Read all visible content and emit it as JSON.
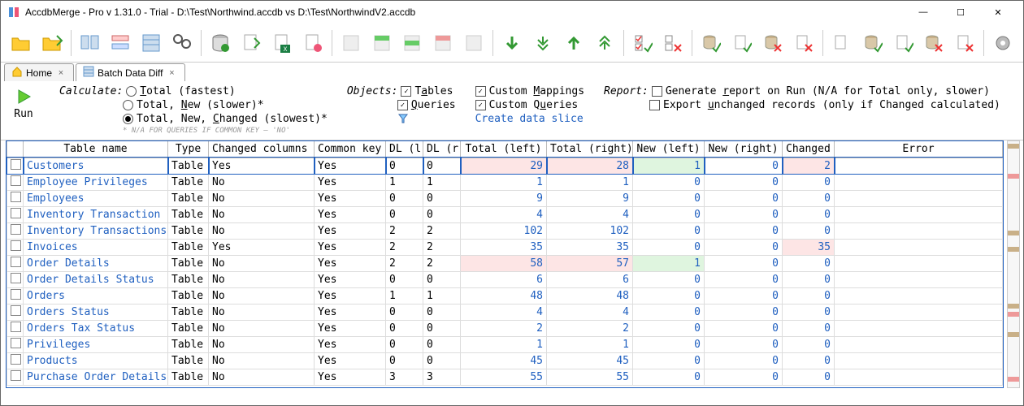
{
  "window": {
    "title": "AccdbMerge - Pro v 1.31.0 - Trial - D:\\Test\\Northwind.accdb vs D:\\Test\\NorthwindV2.accdb"
  },
  "tabs": {
    "home": "Home",
    "active": "Batch Data Diff"
  },
  "run": {
    "label": "Run"
  },
  "calculate": {
    "label": "Calculate:",
    "opt1": "Total (fastest)",
    "opt2": "Total, New (slower)*",
    "opt3": "Total, New, Changed (slowest)*",
    "fine": "* N/A FOR QUERIES IF COMMON KEY – 'NO'"
  },
  "objects": {
    "label": "Objects:",
    "tables": "Tables",
    "queries": "Queries"
  },
  "custom": {
    "mappings": "Custom Mappings",
    "queries": "Custom Queries",
    "slice": "Create data slice"
  },
  "report": {
    "label": "Report:",
    "generate": "Generate report on Run (N/A for Total only, slower)",
    "export": "Export unchanged records (only if Changed calculated)"
  },
  "columns": {
    "c0": "",
    "c1": "Table name",
    "c2": "Type",
    "c3": "Changed columns",
    "c4": "Common key",
    "c5": "DL (l",
    "c6": "DL (r",
    "c7": "Total (left)",
    "c8": "Total (right)",
    "c9": "New (left)",
    "c10": "New (right)",
    "c11": "Changed",
    "c12": "Error"
  },
  "rows": [
    {
      "name": "Customers",
      "type": "Table",
      "chgcol": "Yes",
      "key": "Yes",
      "dll": "0",
      "dlr": "0",
      "tl": "29",
      "tr": "28",
      "nl": "1",
      "nr": "0",
      "ch": "2",
      "hl": {
        "tl": "pink",
        "tr": "pink",
        "nl": "green",
        "ch": "pink"
      },
      "sel": true
    },
    {
      "name": "Employee Privileges",
      "type": "Table",
      "chgcol": "No",
      "key": "Yes",
      "dll": "1",
      "dlr": "1",
      "tl": "1",
      "tr": "1",
      "nl": "0",
      "nr": "0",
      "ch": "0"
    },
    {
      "name": "Employees",
      "type": "Table",
      "chgcol": "No",
      "key": "Yes",
      "dll": "0",
      "dlr": "0",
      "tl": "9",
      "tr": "9",
      "nl": "0",
      "nr": "0",
      "ch": "0"
    },
    {
      "name": "Inventory Transaction",
      "type": "Table",
      "chgcol": "No",
      "key": "Yes",
      "dll": "0",
      "dlr": "0",
      "tl": "4",
      "tr": "4",
      "nl": "0",
      "nr": "0",
      "ch": "0"
    },
    {
      "name": "Inventory Transactions",
      "type": "Table",
      "chgcol": "No",
      "key": "Yes",
      "dll": "2",
      "dlr": "2",
      "tl": "102",
      "tr": "102",
      "nl": "0",
      "nr": "0",
      "ch": "0"
    },
    {
      "name": "Invoices",
      "type": "Table",
      "chgcol": "Yes",
      "key": "Yes",
      "dll": "2",
      "dlr": "2",
      "tl": "35",
      "tr": "35",
      "nl": "0",
      "nr": "0",
      "ch": "35",
      "hl": {
        "ch": "pink"
      }
    },
    {
      "name": "Order Details",
      "type": "Table",
      "chgcol": "No",
      "key": "Yes",
      "dll": "2",
      "dlr": "2",
      "tl": "58",
      "tr": "57",
      "nl": "1",
      "nr": "0",
      "ch": "0",
      "hl": {
        "tl": "pink",
        "tr": "pink",
        "nl": "green"
      }
    },
    {
      "name": "Order Details Status",
      "type": "Table",
      "chgcol": "No",
      "key": "Yes",
      "dll": "0",
      "dlr": "0",
      "tl": "6",
      "tr": "6",
      "nl": "0",
      "nr": "0",
      "ch": "0"
    },
    {
      "name": "Orders",
      "type": "Table",
      "chgcol": "No",
      "key": "Yes",
      "dll": "1",
      "dlr": "1",
      "tl": "48",
      "tr": "48",
      "nl": "0",
      "nr": "0",
      "ch": "0"
    },
    {
      "name": "Orders Status",
      "type": "Table",
      "chgcol": "No",
      "key": "Yes",
      "dll": "0",
      "dlr": "0",
      "tl": "4",
      "tr": "4",
      "nl": "0",
      "nr": "0",
      "ch": "0"
    },
    {
      "name": "Orders Tax Status",
      "type": "Table",
      "chgcol": "No",
      "key": "Yes",
      "dll": "0",
      "dlr": "0",
      "tl": "2",
      "tr": "2",
      "nl": "0",
      "nr": "0",
      "ch": "0"
    },
    {
      "name": "Privileges",
      "type": "Table",
      "chgcol": "No",
      "key": "Yes",
      "dll": "0",
      "dlr": "0",
      "tl": "1",
      "tr": "1",
      "nl": "0",
      "nr": "0",
      "ch": "0"
    },
    {
      "name": "Products",
      "type": "Table",
      "chgcol": "No",
      "key": "Yes",
      "dll": "0",
      "dlr": "0",
      "tl": "45",
      "tr": "45",
      "nl": "0",
      "nr": "0",
      "ch": "0"
    },
    {
      "name": "Purchase Order Details",
      "type": "Table",
      "chgcol": "No",
      "key": "Yes",
      "dll": "3",
      "dlr": "3",
      "tl": "55",
      "tr": "55",
      "nl": "0",
      "nr": "0",
      "ch": "0"
    }
  ]
}
